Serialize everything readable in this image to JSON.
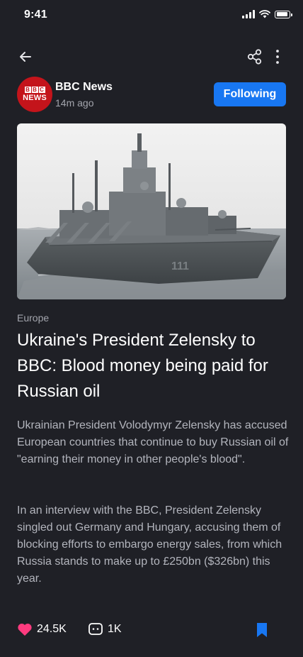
{
  "status_bar": {
    "time": "9:41"
  },
  "source": {
    "name": "BBC News",
    "time_ago": "14m ago",
    "logo_letters": [
      "B",
      "B",
      "C"
    ],
    "logo_text": "NEWS",
    "follow_label": "Following",
    "logo_color": "#c4141b",
    "follow_color": "#1877f2"
  },
  "article": {
    "category": "Europe",
    "headline": "Ukraine's President Zelensky to BBC: Blood money being paid for Russian oil",
    "paragraphs": [
      "Ukrainian President Volodymyr Zelensky has accused European countries that continue to buy Russian oil of \"earning their money in other people's blood\".",
      "In an interview with the BBC, President Zelensky singled out Germany and Hungary, accusing them of blocking efforts to embargo energy sales, from which Russia stands to make up to £250bn ($326bn) this year."
    ]
  },
  "actions": {
    "likes": "24.5K",
    "comments": "1K",
    "like_color": "#ff3b7f",
    "bookmark_color": "#1877f2"
  },
  "icons": {
    "back": "arrow-left-icon",
    "share": "share-icon",
    "more": "more-vertical-icon",
    "like": "heart-icon",
    "comment": "comment-icon",
    "bookmark": "bookmark-icon"
  }
}
